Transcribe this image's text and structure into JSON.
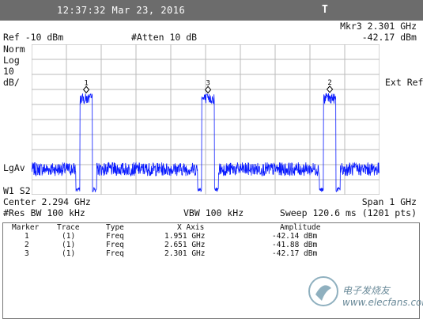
{
  "status_bar": {
    "datetime": "12:37:32  Mar 23, 2016",
    "mode": "T"
  },
  "header": {
    "marker_readout_label": "Mkr3  2.301 GHz",
    "marker_readout_value": "-42.17 dBm",
    "ref_level": "Ref -10 dBm",
    "atten": "#Atten 10 dB",
    "scale_lines": [
      "Norm",
      "Log",
      "10",
      "dB/"
    ],
    "ext_ref": "Ext Ref",
    "lgav": "LgAv",
    "w1s2": "W1  S2"
  },
  "footer": {
    "center": "Center 2.294 GHz",
    "span": "Span 1 GHz",
    "res_bw": "#Res BW 100 kHz",
    "vbw": "VBW 100 kHz",
    "sweep": "Sweep 120.6 ms (1201 pts)"
  },
  "marker_table": {
    "headers": [
      "Marker",
      "Trace",
      "Type",
      "X Axis",
      "Amplitude"
    ],
    "rows": [
      [
        "1",
        "(1)",
        "Freq",
        "1.951 GHz",
        "-42.14 dBm"
      ],
      [
        "2",
        "(1)",
        "Freq",
        "2.651 GHz",
        "-41.88 dBm"
      ],
      [
        "3",
        "(1)",
        "Freq",
        "2.301 GHz",
        "-42.17 dBm"
      ]
    ]
  },
  "watermark": {
    "text": "电子发烧友  www.elecfans.com",
    "icon": "elecfans-logo-icon"
  },
  "colors": {
    "trace": "#0a1bff",
    "titlebar": "#6c6c6c",
    "grid": "#bbbbbb"
  },
  "chart_data": {
    "type": "line",
    "x_unit": "GHz",
    "y_unit": "dBm",
    "xlim": [
      1.794,
      2.794
    ],
    "ylim": [
      -110,
      -10
    ],
    "grid": true,
    "noise_floor_dbm": -93,
    "markers": [
      {
        "label": "1",
        "x": 1.951,
        "y": -42.14
      },
      {
        "label": "2",
        "x": 2.651,
        "y": -41.88
      },
      {
        "label": "3",
        "x": 2.301,
        "y": -42.17
      }
    ]
  }
}
